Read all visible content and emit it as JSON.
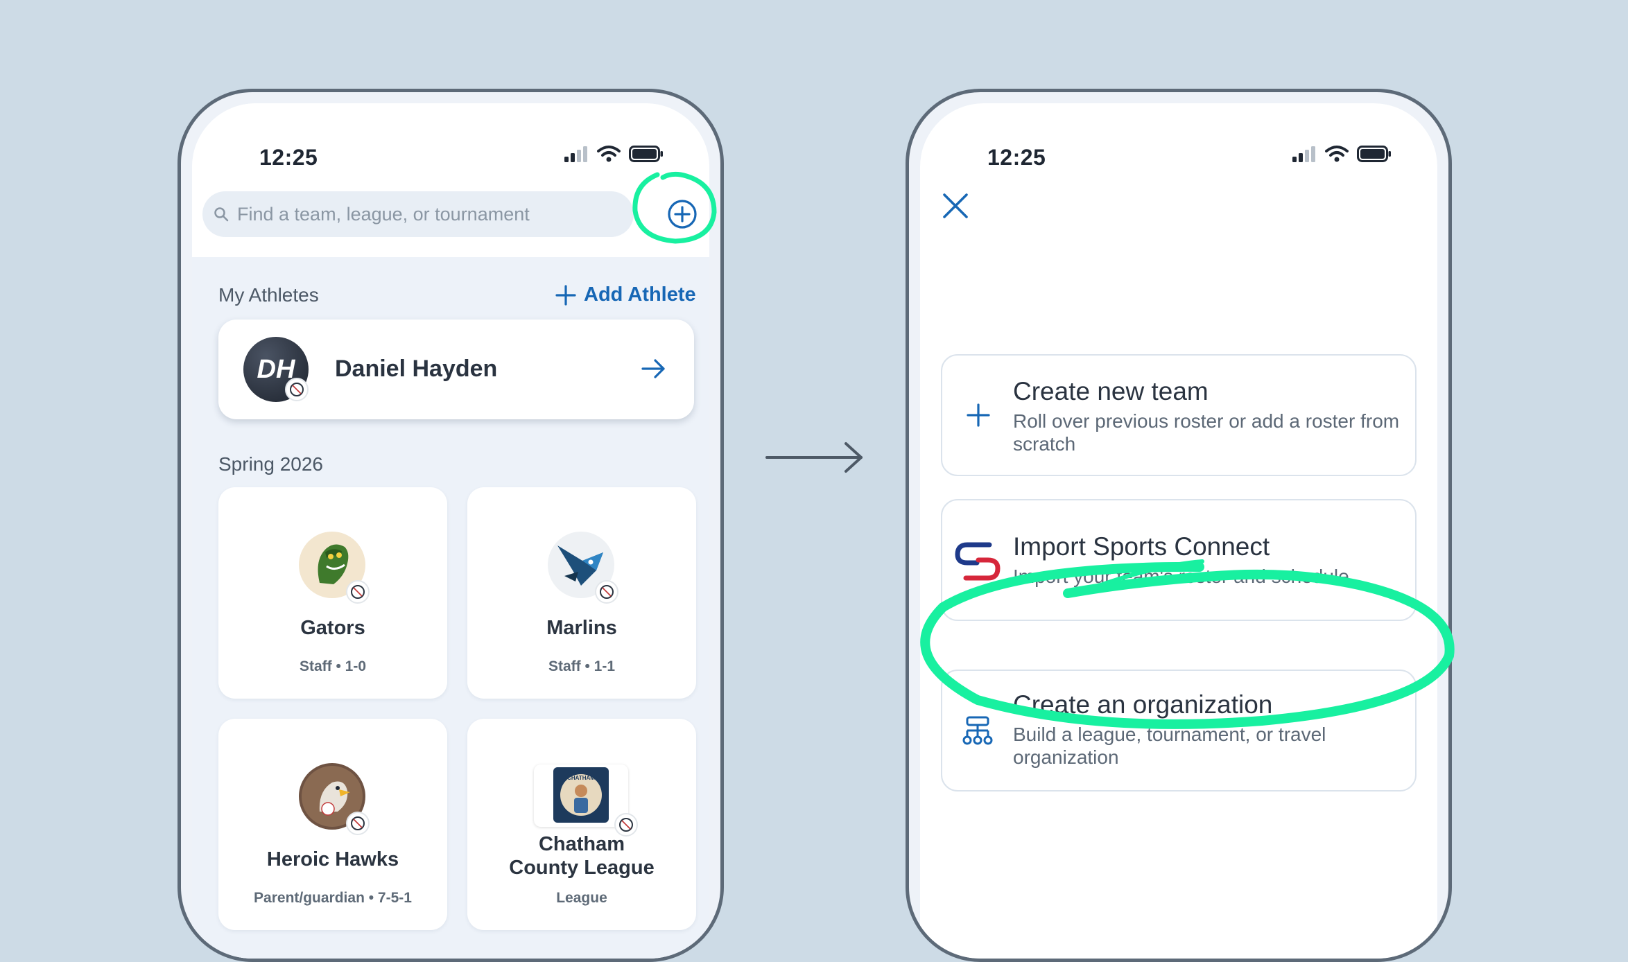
{
  "left_phone": {
    "status_time": "12:25",
    "search": {
      "placeholder": "Find a team, league, or tournament"
    },
    "my_athletes": {
      "label": "My Athletes",
      "add_label": "Add Athlete",
      "athlete": {
        "initials": "DH",
        "name": "Daniel Hayden"
      }
    },
    "season": {
      "label": "Spring 2026",
      "teams": [
        {
          "name": "Gators",
          "sub": "Staff • 1-0"
        },
        {
          "name": "Marlins",
          "sub": "Staff • 1-1"
        },
        {
          "name": "Heroic Hawks",
          "sub": "Parent/guardian • 7-5-1"
        },
        {
          "name": "Chatham County League",
          "name_line1": "Chatham",
          "name_line2": "County League",
          "sub": "League",
          "logo_text": "CHATHAM COUNTY LEAGUE"
        }
      ]
    }
  },
  "right_phone": {
    "status_time": "12:25",
    "options": [
      {
        "title": "Create new team",
        "desc": "Roll over previous roster or add a roster from scratch",
        "icon": "plus-icon"
      },
      {
        "title": "Import Sports Connect",
        "desc": "Import your team's roster and schedule",
        "icon": "sports-connect-logo"
      },
      {
        "title": "Create an organization",
        "desc": "Build a league, tournament, or travel organization",
        "icon": "org-chart-icon"
      }
    ]
  },
  "colors": {
    "background": "#cddbe6",
    "accent_blue": "#1767b5",
    "highlight_green": "#18f0a0",
    "phone_frame": "#5d6a78"
  }
}
